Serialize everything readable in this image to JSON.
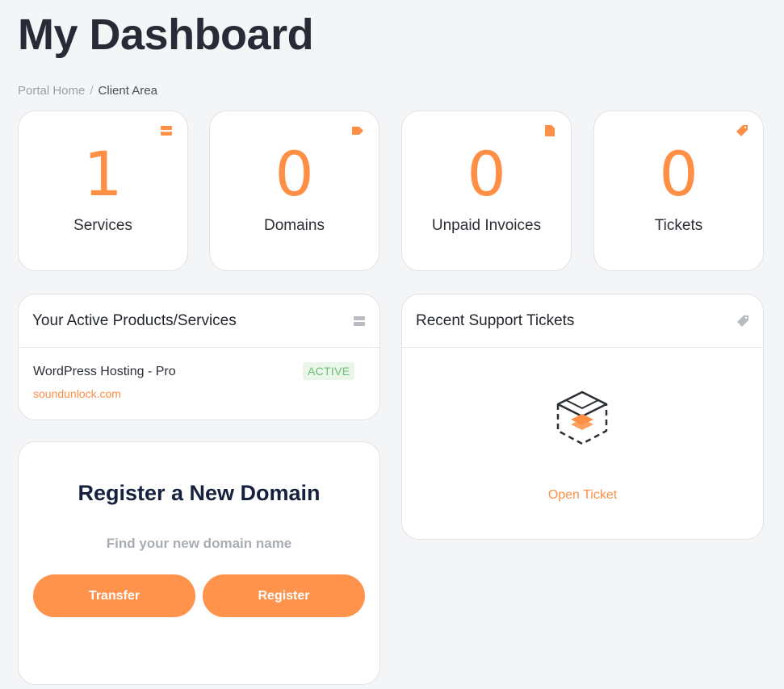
{
  "page": {
    "title": "My Dashboard",
    "breadcrumb": {
      "home": "Portal Home",
      "separator": "/",
      "current": "Client Area"
    }
  },
  "stats": [
    {
      "value": "1",
      "label": "Services",
      "icon": "server-icon"
    },
    {
      "value": "0",
      "label": "Domains",
      "icon": "tag-icon"
    },
    {
      "value": "0",
      "label": "Unpaid Invoices",
      "icon": "document-icon"
    },
    {
      "value": "0",
      "label": "Tickets",
      "icon": "ticket-icon"
    }
  ],
  "products_panel": {
    "title": "Your Active Products/Services",
    "icon": "server-icon",
    "items": [
      {
        "name": "WordPress Hosting - Pro",
        "domain": "soundunlock.com",
        "status": "ACTIVE"
      }
    ]
  },
  "register_panel": {
    "title": "Register a New Domain",
    "subtitle": "Find your new domain name",
    "transfer_label": "Transfer",
    "register_label": "Register"
  },
  "tickets_panel": {
    "title": "Recent Support Tickets",
    "icon": "tag-icon",
    "empty_icon": "open-envelope-icon",
    "action_label": "Open Ticket"
  },
  "colors": {
    "accent": "#ff8f45",
    "success_text": "#6cc070",
    "success_bg": "#eaf6ea",
    "heading": "#16213e",
    "background": "#f4f5f7"
  }
}
